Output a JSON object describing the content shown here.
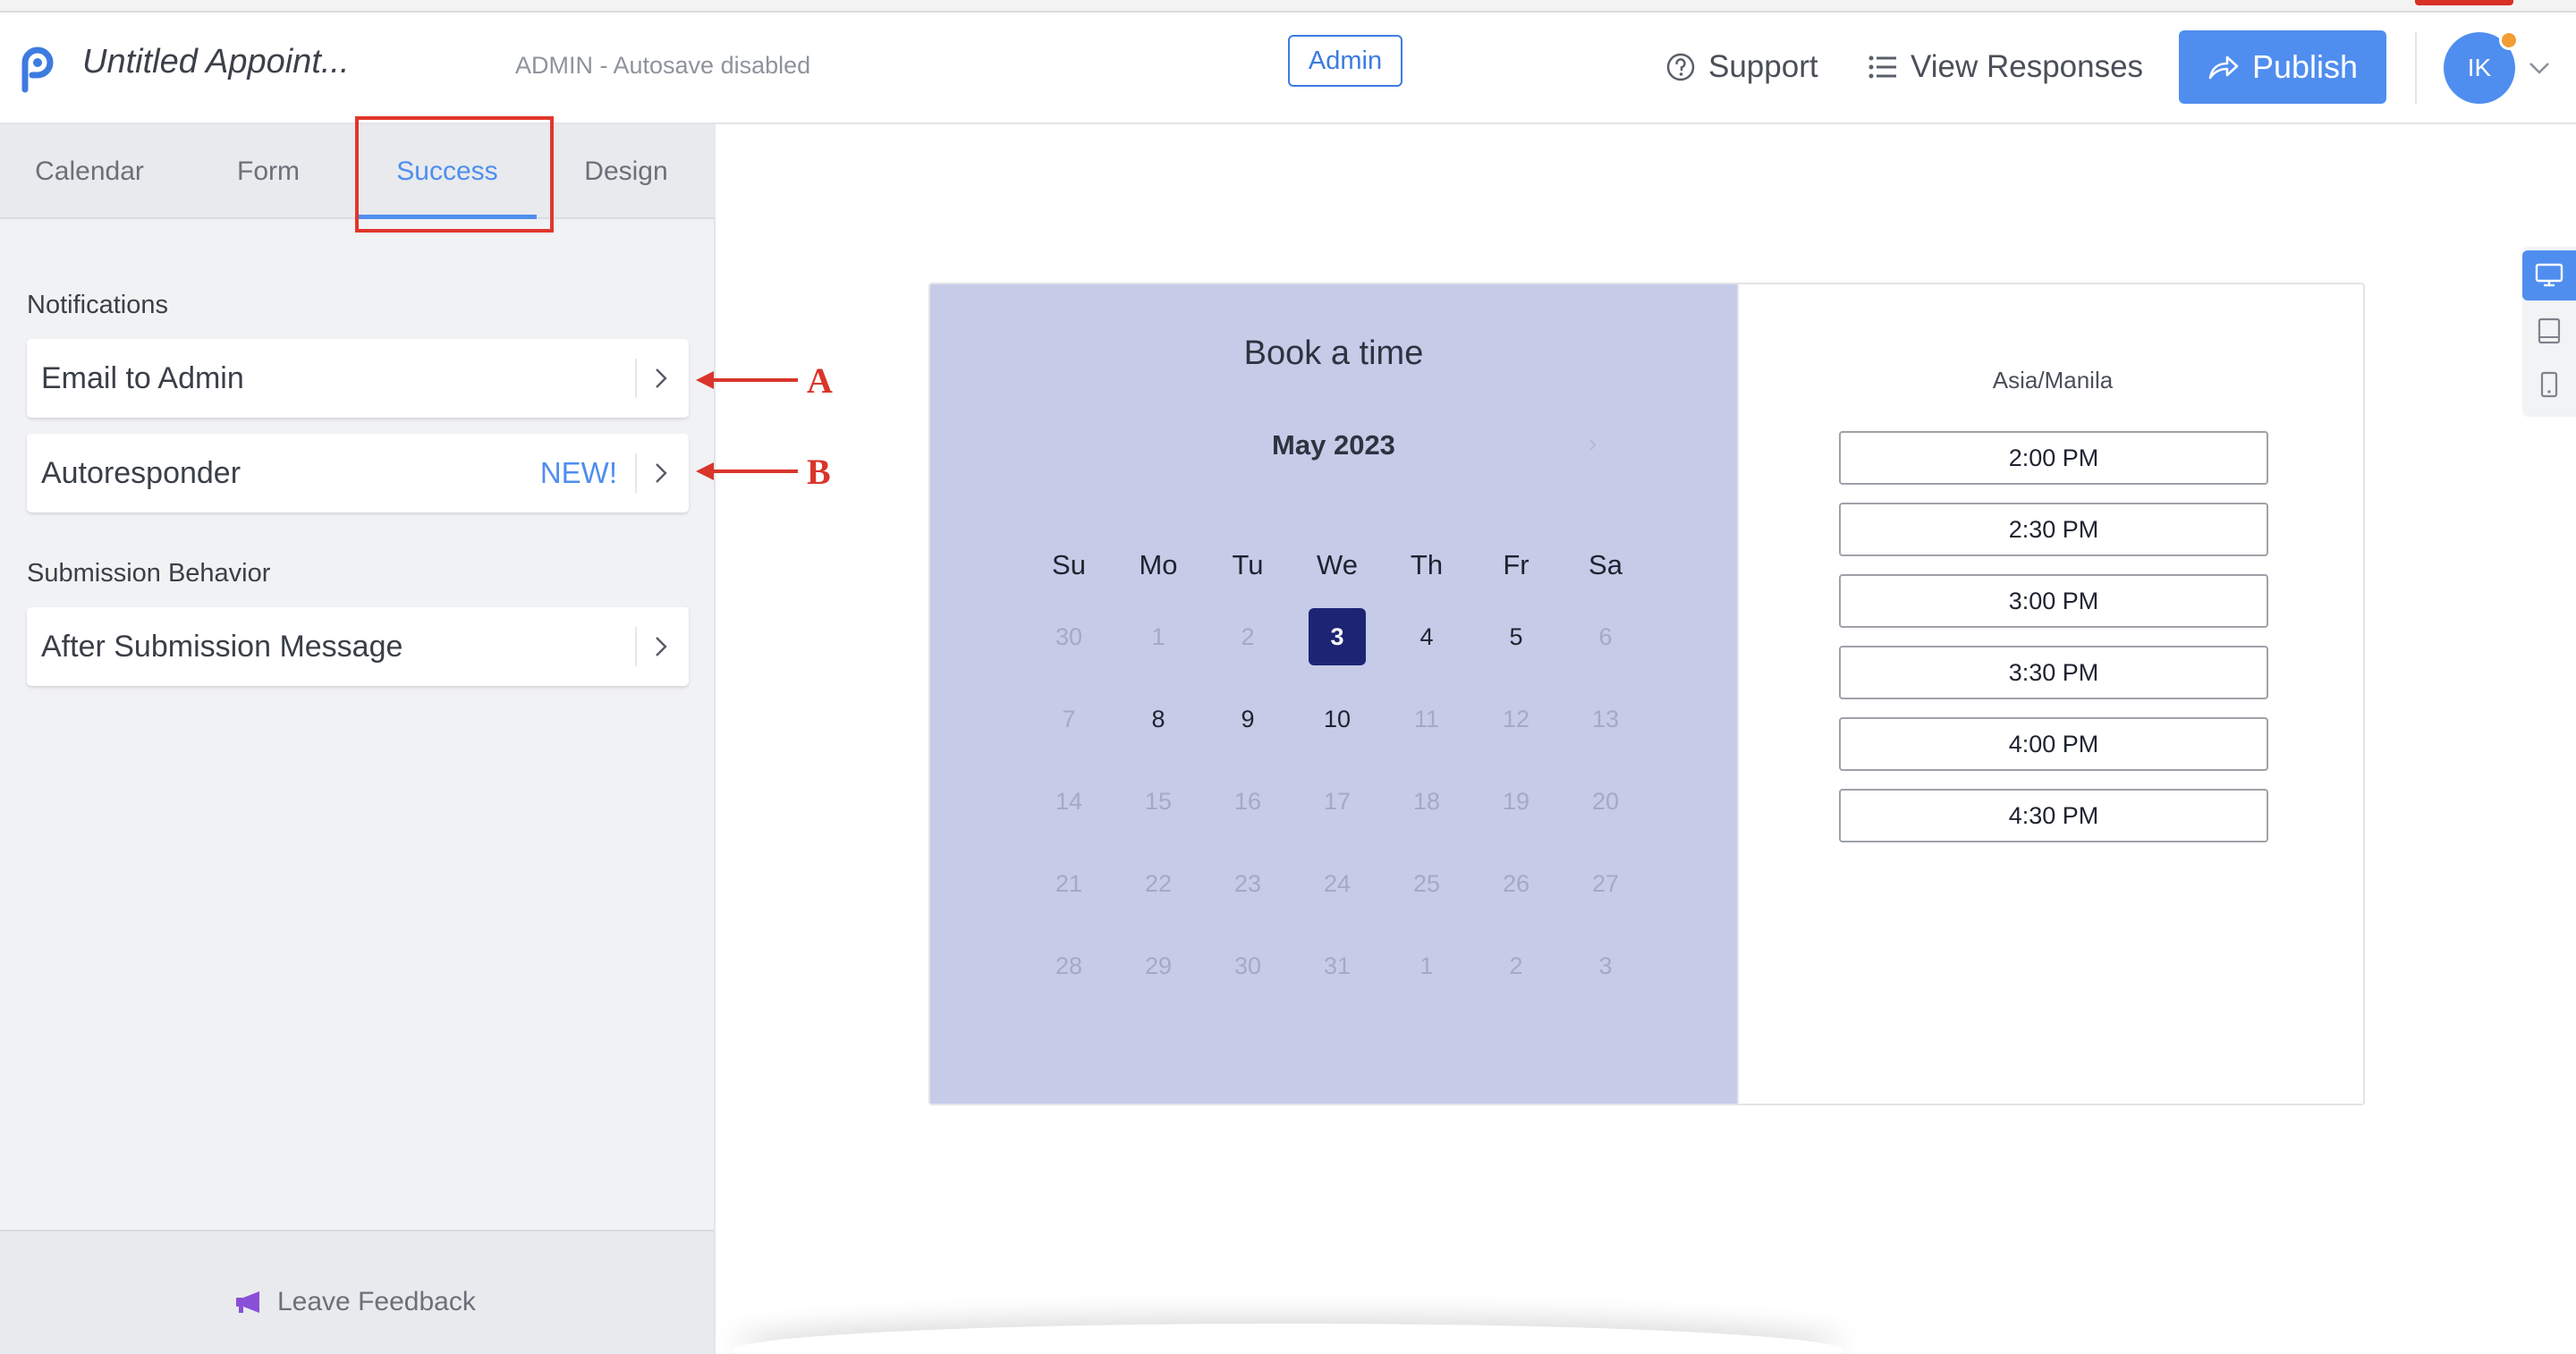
{
  "header": {
    "app_title": "Untitled Appoint...",
    "mode_text": "ADMIN - Autosave disabled",
    "admin_badge": "Admin",
    "support_label": "Support",
    "view_responses_label": "View Responses",
    "publish_label": "Publish",
    "avatar_initials": "IK"
  },
  "colors": {
    "accent": "#4f8eef",
    "calendar_bg": "#c6cbe8",
    "selected_day": "#1d2474",
    "annotation_red": "#d9352a",
    "notification_dot": "#f39c34"
  },
  "sidebar": {
    "tabs": [
      {
        "label": "Calendar",
        "active": false
      },
      {
        "label": "Form",
        "active": false
      },
      {
        "label": "Success",
        "active": true
      },
      {
        "label": "Design",
        "active": false
      }
    ],
    "notifications_heading": "Notifications",
    "notifications": [
      {
        "label": "Email to Admin",
        "badge": ""
      },
      {
        "label": "Autoresponder",
        "badge": "NEW!"
      }
    ],
    "submission_heading": "Submission Behavior",
    "submission": [
      {
        "label": "After Submission Message"
      }
    ],
    "feedback_label": "Leave Feedback"
  },
  "annotations": {
    "a": "A",
    "b": "B"
  },
  "preview": {
    "title": "Book a time",
    "month": "May 2023",
    "weekdays": [
      "Su",
      "Mo",
      "Tu",
      "We",
      "Th",
      "Fr",
      "Sa"
    ],
    "weeks": [
      [
        {
          "d": "30",
          "s": "muted"
        },
        {
          "d": "1",
          "s": "muted"
        },
        {
          "d": "2",
          "s": "muted"
        },
        {
          "d": "3",
          "s": "selected"
        },
        {
          "d": "4",
          "s": "avail"
        },
        {
          "d": "5",
          "s": "avail"
        },
        {
          "d": "6",
          "s": "muted"
        }
      ],
      [
        {
          "d": "7",
          "s": "muted"
        },
        {
          "d": "8",
          "s": "avail"
        },
        {
          "d": "9",
          "s": "avail"
        },
        {
          "d": "10",
          "s": "avail"
        },
        {
          "d": "11",
          "s": "muted"
        },
        {
          "d": "12",
          "s": "muted"
        },
        {
          "d": "13",
          "s": "muted"
        }
      ],
      [
        {
          "d": "14",
          "s": "muted"
        },
        {
          "d": "15",
          "s": "muted"
        },
        {
          "d": "16",
          "s": "muted"
        },
        {
          "d": "17",
          "s": "muted"
        },
        {
          "d": "18",
          "s": "muted"
        },
        {
          "d": "19",
          "s": "muted"
        },
        {
          "d": "20",
          "s": "muted"
        }
      ],
      [
        {
          "d": "21",
          "s": "muted"
        },
        {
          "d": "22",
          "s": "muted"
        },
        {
          "d": "23",
          "s": "muted"
        },
        {
          "d": "24",
          "s": "muted"
        },
        {
          "d": "25",
          "s": "muted"
        },
        {
          "d": "26",
          "s": "muted"
        },
        {
          "d": "27",
          "s": "muted"
        }
      ],
      [
        {
          "d": "28",
          "s": "muted"
        },
        {
          "d": "29",
          "s": "muted"
        },
        {
          "d": "30",
          "s": "muted"
        },
        {
          "d": "31",
          "s": "muted"
        },
        {
          "d": "1",
          "s": "muted"
        },
        {
          "d": "2",
          "s": "muted"
        },
        {
          "d": "3",
          "s": "muted"
        }
      ]
    ],
    "timezone": "Asia/Manila",
    "slots": [
      "2:00 PM",
      "2:30 PM",
      "3:00 PM",
      "3:30 PM",
      "4:00 PM",
      "4:30 PM"
    ]
  },
  "device_switcher": [
    {
      "icon": "desktop-icon",
      "active": true
    },
    {
      "icon": "tablet-icon",
      "active": false
    },
    {
      "icon": "mobile-icon",
      "active": false
    }
  ]
}
